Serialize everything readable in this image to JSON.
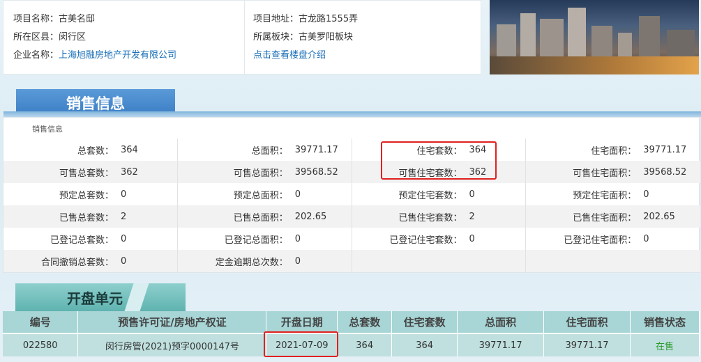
{
  "project": {
    "name_label": "项目名称：",
    "name": "古美名邸",
    "district_label": "所在区县：",
    "district": "闵行区",
    "company_label": "企业名称：",
    "company": "上海旭融房地产开发有限公司",
    "address_label": "项目地址：",
    "address": "古龙路1555弄",
    "block_label": "所属板块：",
    "block": "古美罗阳板块",
    "intro_link": "点击查看楼盘介绍"
  },
  "sales": {
    "tab_title": "销售信息",
    "caption": "销售信息",
    "rows": [
      [
        {
          "label": "总套数：",
          "value": "364"
        },
        {
          "label": "总面积：",
          "value": "39771.17"
        },
        {
          "label": "住宅套数：",
          "value": "364"
        },
        {
          "label": "住宅面积：",
          "value": "39771.17"
        }
      ],
      [
        {
          "label": "可售总套数：",
          "value": "362"
        },
        {
          "label": "可售总面积：",
          "value": "39568.52"
        },
        {
          "label": "可售住宅套数：",
          "value": "362"
        },
        {
          "label": "可售住宅面积：",
          "value": "39568.52"
        }
      ],
      [
        {
          "label": "预定总套数：",
          "value": "0"
        },
        {
          "label": "预定总面积：",
          "value": "0"
        },
        {
          "label": "预定住宅套数：",
          "value": "0"
        },
        {
          "label": "预定住宅面积：",
          "value": "0"
        }
      ],
      [
        {
          "label": "已售总套数：",
          "value": "2"
        },
        {
          "label": "已售总面积：",
          "value": "202.65"
        },
        {
          "label": "已售住宅套数：",
          "value": "2"
        },
        {
          "label": "已售住宅面积：",
          "value": "202.65"
        }
      ],
      [
        {
          "label": "已登记总套数：",
          "value": "0"
        },
        {
          "label": "已登记总面积：",
          "value": "0"
        },
        {
          "label": "已登记住宅套数：",
          "value": "0"
        },
        {
          "label": "已登记住宅面积：",
          "value": "0"
        }
      ],
      [
        {
          "label": "合同撤销总套数：",
          "value": "0"
        },
        {
          "label": "定金逾期总次数：",
          "value": "0"
        },
        {
          "label": "",
          "value": ""
        },
        {
          "label": "",
          "value": ""
        }
      ]
    ]
  },
  "units": {
    "tab_title": "开盘单元",
    "headers": [
      "编号",
      "预售许可证/房地产权证",
      "开盘日期",
      "总套数",
      "住宅套数",
      "总面积",
      "住宅面积",
      "销售状态"
    ],
    "rows": [
      {
        "id": "022580",
        "permit": "闵行房管(2021)预字0000147号",
        "open_date": "2021-07-09",
        "total_units": "364",
        "residential_units": "364",
        "total_area": "39771.17",
        "residential_area": "39771.17",
        "status": "在售"
      }
    ]
  },
  "colors": {
    "highlight_border": "#e02020",
    "sales_tab": "#3a7cc4",
    "units_tab": "#5fb3b0",
    "link": "#1a6fb8",
    "status_on_sale": "#2a9a2a"
  }
}
